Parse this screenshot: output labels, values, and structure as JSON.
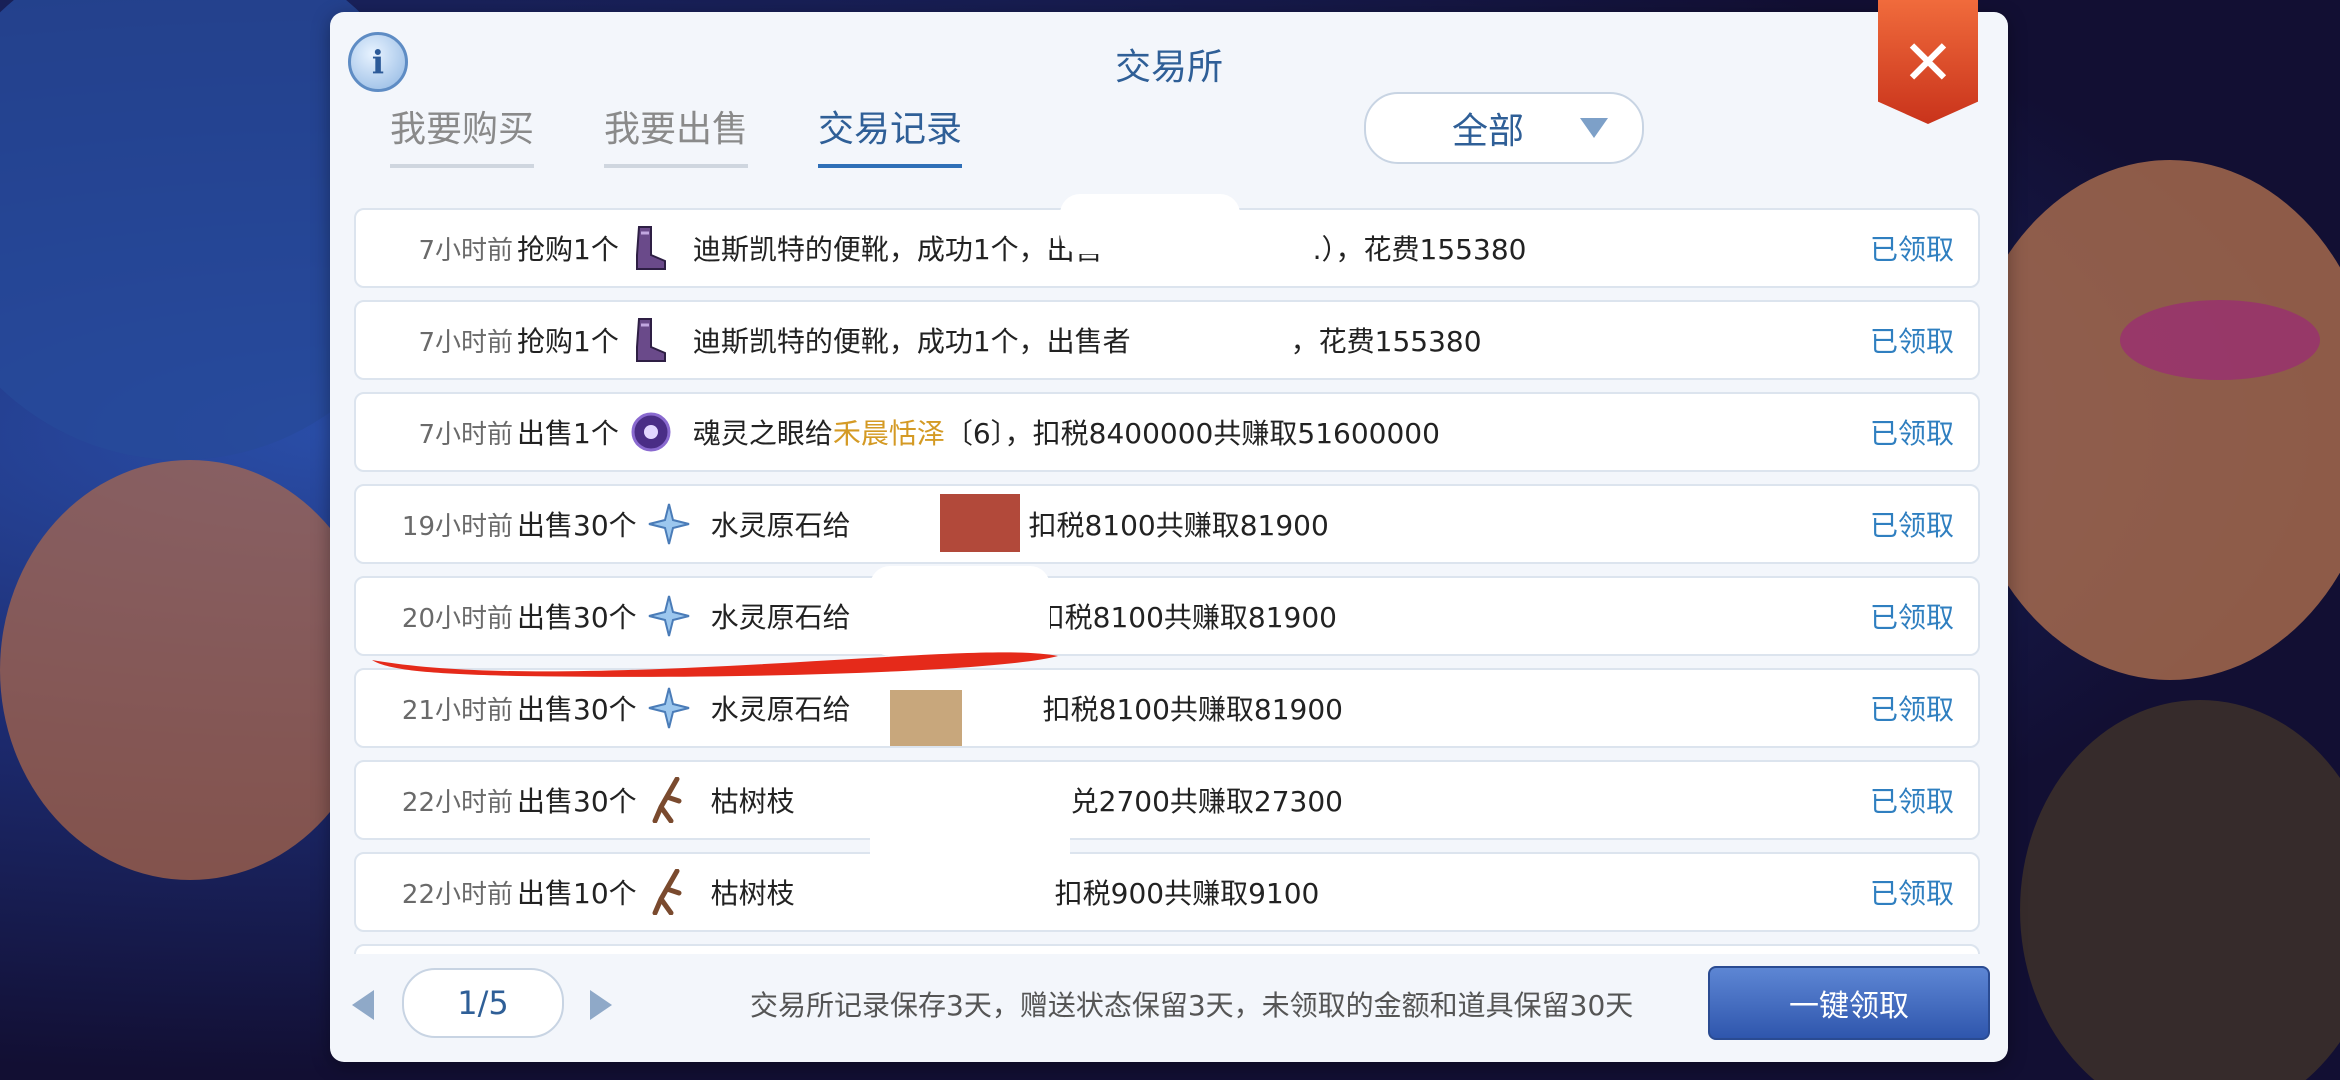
{
  "window": {
    "title": "交易所"
  },
  "info_glyph": "i",
  "close_glyph": "✕",
  "tabs": [
    {
      "label": "我要购买"
    },
    {
      "label": "我要出售"
    },
    {
      "label": "交易记录",
      "active": true
    }
  ],
  "filter": {
    "selected": "全部"
  },
  "records": [
    {
      "time": "7小时前",
      "action": "抢购1个",
      "icon": "purple-boots",
      "msg": "迪斯凯特的便靴，成功1个，出售",
      "msg_tail": ".），花费155380",
      "claim": "已领取"
    },
    {
      "time": "7小时前",
      "action": "抢购1个",
      "icon": "purple-boots",
      "msg": "迪斯凯特的便靴，成功1个，出售者",
      "msg_tail": "，花费155380",
      "claim": "已领取"
    },
    {
      "time": "7小时前",
      "action": "出售1个",
      "icon": "soul-eye-orb",
      "msg": "魂灵之眼给",
      "highlight": "禾晨恬泽",
      "msg_tail": "〔6〕，扣税8400000共赚取51600000",
      "claim": "已领取"
    },
    {
      "time": "19小时前",
      "action": "出售30个",
      "icon": "ice-crystal",
      "msg": "水灵原石给",
      "msg_tail": "1〕，扣税8100共赚取81900",
      "claim": "已领取"
    },
    {
      "time": "20小时前",
      "action": "出售30个",
      "icon": "ice-crystal",
      "msg": "水灵原石给",
      "msg_tail": "扣税8100共赚取81900",
      "claim": "已领取"
    },
    {
      "time": "21小时前",
      "action": "出售30个",
      "icon": "ice-crystal",
      "msg": "水灵原石给",
      "msg_tail": "扣税8100共赚取81900",
      "claim": "已领取"
    },
    {
      "time": "22小时前",
      "action": "出售30个",
      "icon": "dead-branch",
      "msg": "枯树枝",
      "msg_tail": "兑2700共赚取27300",
      "claim": "已领取"
    },
    {
      "time": "22小时前",
      "action": "出售10个",
      "icon": "dead-branch",
      "msg": "枯树枝",
      "msg_tail": "扣税900共赚取9100",
      "claim": "已领取"
    }
  ],
  "pager": {
    "label": "1/5"
  },
  "footnote": "交易所记录保存3天，赠送状态保留3天，未领取的金额和道具保留30天",
  "claim_all": "一键领取",
  "colors": {
    "accent": "#2f5f97",
    "highlight": "#d49a24",
    "claim": "#2f7fc0",
    "close": "#e04a2a"
  }
}
